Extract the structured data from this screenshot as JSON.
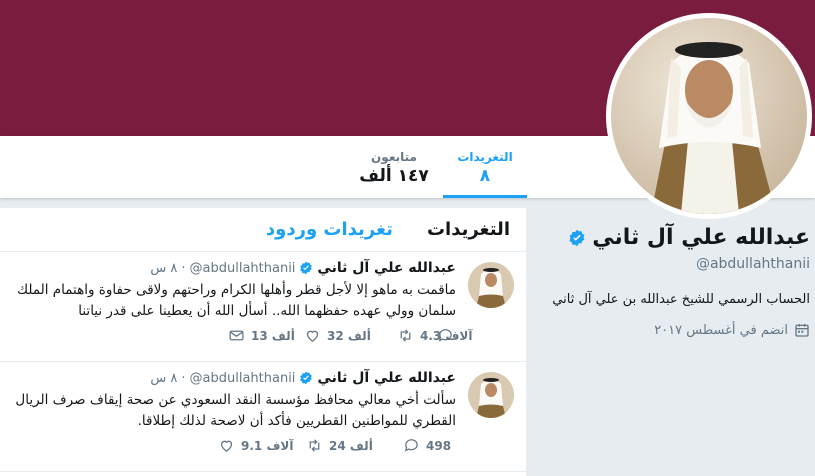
{
  "profile": {
    "name": "عبدالله علي آل ثاني",
    "handle": "@abdullahthanii",
    "bio": "الحساب الرسمي للشيخ عبدالله بن علي آل ثاني",
    "joined": "انضم في أغسطس ٢٠١٧"
  },
  "nav": {
    "tweets_label": "التغريدات",
    "tweets_count": "٨",
    "followers_label": "متابعون",
    "followers_count": "١٤٧ ألف"
  },
  "timeline": {
    "tabs": [
      {
        "label": "التغريدات",
        "active": true
      },
      {
        "label": "تغريدات وردود",
        "active": false
      }
    ]
  },
  "tweets": [
    {
      "name": "عبدالله علي آل ثاني",
      "handle": "@abdullahthanii",
      "time": "٨ س",
      "text": "ماقمت به ماهو إلا لأجل قطر وأهلها الكرام وراحتهم ولاقى حفاوة واهتمام الملك سلمان وولي عهده حفظهما الله.. أسأل الله أن يعطينا على قدر نياتنا",
      "replies": "",
      "retweets": "4.3 آلاف",
      "likes": "32 ألف",
      "messages": "13 ألف"
    },
    {
      "name": "عبدالله علي آل ثاني",
      "handle": "@abdullahthanii",
      "time": "٨ س",
      "text": "سألت أخي معالي محافظ مؤسسة النقد السعودي عن صحة إيقاف صرف الريال القطري للمواطنين القطريين فأكد أن لاصحة لذلك إطلاقا.",
      "replies": "498",
      "retweets": "24 ألف",
      "likes": "9.1 آلاف",
      "messages": ""
    }
  ],
  "colors": {
    "banner": "#7a1c3f",
    "accent": "#1da1f2",
    "muted": "#657786"
  },
  "icons": [
    "verified-icon",
    "calendar-icon",
    "reply-icon",
    "retweet-icon",
    "like-icon",
    "message-icon"
  ]
}
